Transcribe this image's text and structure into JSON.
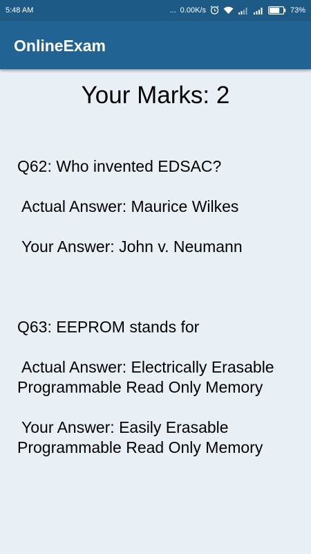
{
  "status_bar": {
    "time": "5:48 AM",
    "dots": "...",
    "speed": "0.00K/s",
    "battery": "73%"
  },
  "app_bar": {
    "title": "OnlineExam"
  },
  "result": {
    "marks_label": "Your Marks: 2"
  },
  "questions": [
    {
      "question": "Q62: Who invented EDSAC?",
      "actual": "Actual Answer: Maurice Wilkes",
      "yours": "Your Answer: John v. Neumann"
    },
    {
      "question": "Q63: EEPROM stands for",
      "actual": "Actual Answer: Electrically Erasable Programmable Read Only Memory",
      "yours": "Your Answer: Easily Erasable Programmable Read Only Memory"
    }
  ],
  "colors": {
    "status_bar": "#1d5a85",
    "app_bar": "#216494",
    "background": "#e8eff5"
  }
}
